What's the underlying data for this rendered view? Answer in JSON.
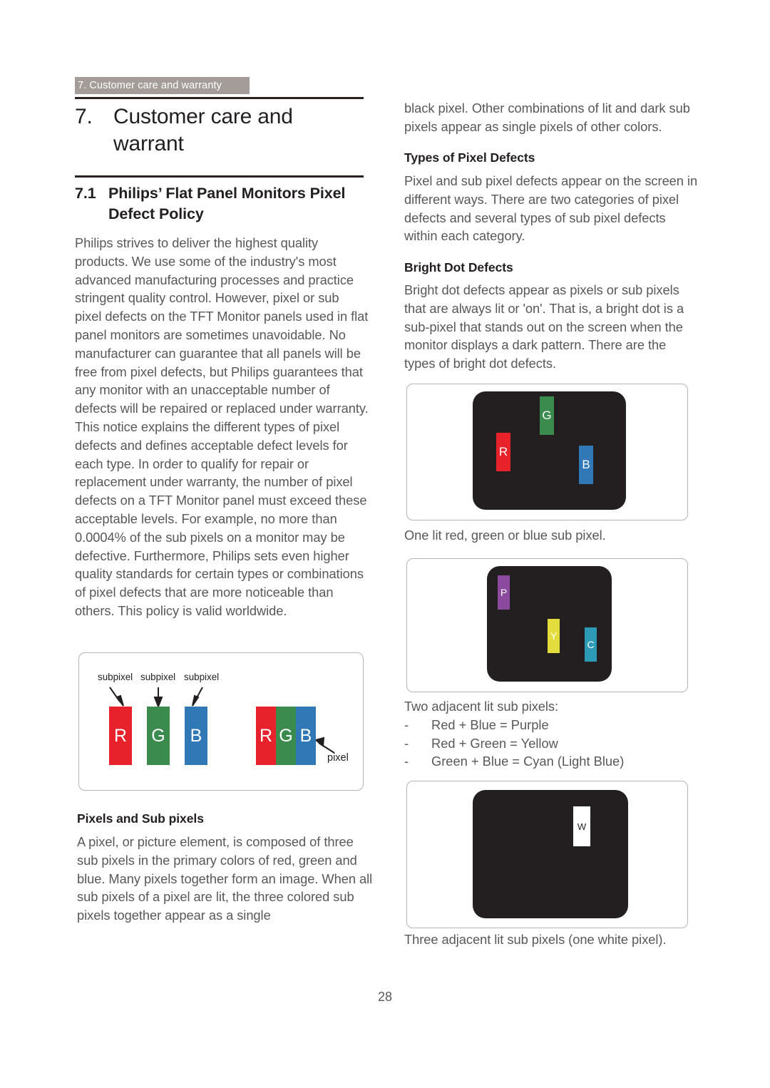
{
  "document": {
    "running_header": "7. Customer care and warranty",
    "page_number": "28",
    "chapter": {
      "number": "7.",
      "title": "Customer care and warrant"
    },
    "section": {
      "number": "7.1",
      "title": "Philips’ Flat Panel Monitors Pixel Defect Policy"
    }
  },
  "left_column": {
    "intro_paragraph": "Philips strives to deliver the highest quality products. We use some of the industry's most advanced manufacturing processes and practice stringent quality control. However, pixel or sub pixel defects on the TFT Monitor panels used in flat panel monitors are sometimes unavoidable. No manufacturer can guarantee that all panels will be free from pixel defects, but Philips guarantees that any monitor with an unacceptable number of defects will be repaired or replaced under warranty. This notice explains the different types of pixel defects and defines acceptable defect levels for each type. In order to qualify for repair or replacement under warranty, the number of pixel defects on a TFT Monitor panel must exceed these acceptable levels. For example, no more than 0.0004% of the sub pixels on a monitor may be defective. Furthermore, Philips sets even higher quality standards for certain types or combinations of pixel defects that are more noticeable than others. This policy is valid worldwide.",
    "subpixel_figure": {
      "callout_labels": [
        "subpixel",
        "subpixel",
        "subpixel"
      ],
      "separate_bars": [
        {
          "letter": "R",
          "color": "#e8222b"
        },
        {
          "letter": "G",
          "color": "#3b8b4f"
        },
        {
          "letter": "B",
          "color": "#3179b6"
        }
      ],
      "joined_bars": [
        {
          "letter": "R",
          "color": "#e8222b"
        },
        {
          "letter": "G",
          "color": "#3b8b4f"
        },
        {
          "letter": "B",
          "color": "#3179b6"
        }
      ],
      "pixel_label": "pixel"
    },
    "pixels_heading": "Pixels and Sub pixels",
    "pixels_paragraph": "A pixel, or picture element, is composed of three sub pixels in the primary colors of red, green and blue. Many pixels together form an image. When all sub pixels of a pixel are lit, the three colored sub pixels together appear as a single"
  },
  "right_column": {
    "continuation_paragraph": "black pixel. Other combinations of lit and dark sub pixels appear as single pixels of other colors.",
    "types_heading": "Types of Pixel Defects",
    "types_paragraph": "Pixel and sub pixel defects appear on the screen in different ways. There are two categories of pixel defects and several types of sub pixel defects within each category.",
    "bright_heading": "Bright Dot Defects",
    "bright_paragraph": "Bright dot defects appear as pixels or sub pixels that are always lit or 'on'. That is, a bright dot is a sub-pixel that stands out on the screen when the monitor displays a dark pattern. There are the types of bright dot defects.",
    "figure_one": {
      "screen_color": "#231f20",
      "dots": [
        {
          "letter": "R",
          "color": "#e8222b"
        },
        {
          "letter": "G",
          "color": "#3b8b4f"
        },
        {
          "letter": "B",
          "color": "#3179b6"
        }
      ],
      "caption": "One lit red, green or blue sub pixel."
    },
    "figure_two": {
      "screen_color": "#231f20",
      "dots": [
        {
          "letter": "P",
          "color": "#8b4a9e"
        },
        {
          "letter": "Y",
          "color": "#e2dc3d"
        },
        {
          "letter": "C",
          "color": "#2d9bb5"
        }
      ],
      "caption_intro": "Two adjacent lit sub pixels:",
      "caption_items": [
        "Red + Blue = Purple",
        "Red + Green = Yellow",
        "Green + Blue = Cyan (Light Blue)"
      ],
      "dash": "-"
    },
    "figure_three": {
      "screen_color": "#231f20",
      "dots": [
        {
          "letter": "W",
          "color": "#ffffff"
        }
      ],
      "caption": "Three adjacent lit sub pixels (one white pixel)."
    }
  },
  "colors": {
    "header_tag_bg": "#a39c98",
    "rule": "#2a211f",
    "body_text": "#58585b",
    "heading_text": "#231f20",
    "figure_border": "#b9b3b6"
  }
}
